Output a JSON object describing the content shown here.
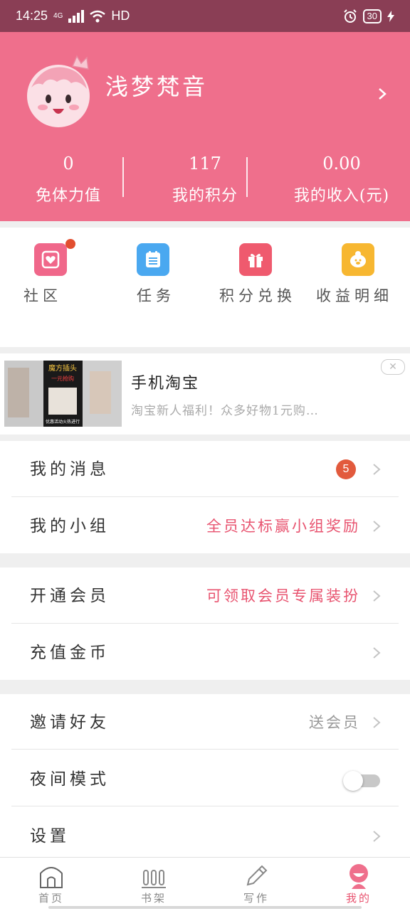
{
  "status_bar": {
    "time": "14:25",
    "network": "4G",
    "hd": "HD",
    "battery": "30"
  },
  "profile": {
    "username": "浅梦梵音"
  },
  "stats": [
    {
      "value": "0",
      "label": "免体力值"
    },
    {
      "value": "117",
      "label": "我的积分"
    },
    {
      "value": "0.00",
      "label": "我的收入(元)"
    }
  ],
  "quick_actions": [
    {
      "label": "社区",
      "icon": "community-icon",
      "color": "#f0678a"
    },
    {
      "label": "任务",
      "icon": "task-list-icon",
      "color": "#4aa8f0"
    },
    {
      "label": "积分兑换",
      "icon": "gift-icon",
      "color": "#ef5a6e"
    },
    {
      "label": "收益明细",
      "icon": "piggy-bank-icon",
      "color": "#f7b731"
    }
  ],
  "ad": {
    "title": "手机淘宝",
    "description": "淘宝新人福利！众多好物1元购…",
    "thumb_text_top": "魔方插头",
    "thumb_text_sub": "一元抢购",
    "thumb_text_bottom": "优惠活动火热进行"
  },
  "menu": {
    "messages": {
      "label": "我的消息",
      "badge": "5"
    },
    "group": {
      "label": "我的小组",
      "extra": "全员达标赢小组奖励"
    },
    "vip": {
      "label": "开通会员",
      "extra": "可领取会员专属装扮"
    },
    "recharge": {
      "label": "充值金币"
    },
    "invite": {
      "label": "邀请好友",
      "extra": "送会员"
    },
    "night_mode": {
      "label": "夜间模式",
      "enabled": false
    },
    "settings": {
      "label": "设置"
    }
  },
  "tabs": [
    {
      "label": "首页",
      "icon": "home-icon"
    },
    {
      "label": "书架",
      "icon": "bookshelf-icon"
    },
    {
      "label": "写作",
      "icon": "pen-icon"
    },
    {
      "label": "我的",
      "icon": "profile-icon",
      "active": true
    }
  ],
  "colors": {
    "brand_pink": "#ef6f8c",
    "accent_red": "#e8536f",
    "status_bar": "#8a3e55"
  }
}
